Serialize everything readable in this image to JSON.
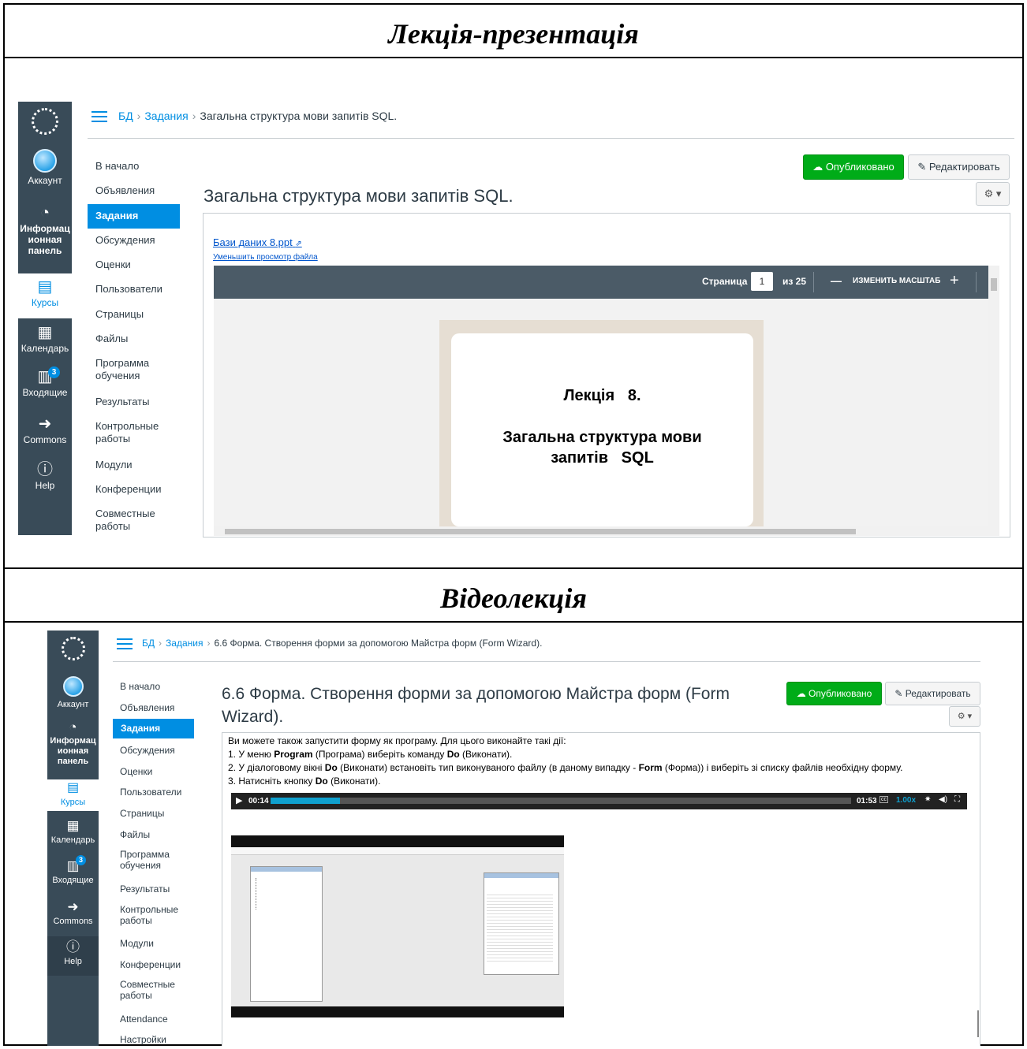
{
  "sections": {
    "top_title": "Лекція-презентація",
    "bottom_title": "Відеолекція"
  },
  "global_nav": {
    "account": "Аккаунт",
    "dashboard": "Информац ионная панель",
    "courses": "Курсы",
    "calendar": "Календарь",
    "inbox": "Входящие",
    "inbox_badge": "3",
    "commons": "Commons",
    "help": "Help"
  },
  "course_nav": {
    "home": "В начало",
    "announcements": "Объявления",
    "assignments": "Задания",
    "discussions": "Обсуждения",
    "grades": "Оценки",
    "people": "Пользователи",
    "pages": "Страницы",
    "files": "Файлы",
    "syllabus": "Программа обучения",
    "outcomes": "Результаты",
    "quizzes": "Контрольные работы",
    "modules": "Модули",
    "conferences": "Конференции",
    "collaborations": "Совместные работы",
    "attendance": "Attendance",
    "settings": "Настройки"
  },
  "breadcrumb": {
    "course": "БД",
    "section": "Задания",
    "sep": "›",
    "page1": "Загальна структура мови запитів SQL.",
    "page2": "6.6 Форма. Створення форми за допомогою Майстра форм (Form Wizard)."
  },
  "buttons": {
    "published": "Опубликовано",
    "edit": "Редактировать",
    "gear": "⚙ ▾"
  },
  "presentation": {
    "heading": "Загальна структура мови запитів SQL.",
    "file_link": "Бази даних 8.ppt",
    "collapse_link": "Уменьшить просмотр файла",
    "page_label": "Страница",
    "page_value": "1",
    "page_of": "из 25",
    "zoom_label": "ИЗМЕНИТЬ МАСШТАБ",
    "zoom_minus": "—",
    "zoom_plus": "+",
    "slide_line1": "Лекція   8.",
    "slide_line2": "Загальна структура мови",
    "slide_line3": "запитів   SQL"
  },
  "video_lecture": {
    "heading_line1": "6.6 Форма. Створення форми за допомогою Майстра форм (Form",
    "heading_line2": "Wizard).",
    "text_line1": "Ви можете також запустити форму як програму. Для цього виконайте такі дії:",
    "text_line2_a": "1. У меню ",
    "text_line2_b": "Program",
    "text_line2_c": " (Програма) виберіть команду ",
    "text_line2_d": "Do",
    "text_line2_e": " (Виконати).",
    "text_line3_a": "2. У діалоговому вікні ",
    "text_line3_b": "Do",
    "text_line3_c": " (Виконати) встановіть тип виконуваного файлу (в даному випадку - ",
    "text_line3_d": "Form",
    "text_line3_e": " (Форма)) і виберіть зі списку файлів необхідну форму.",
    "text_line4_a": "3. Натисніть кнопку ",
    "text_line4_b": "Do",
    "text_line4_c": " (Виконати).",
    "current_time": "00:14",
    "duration": "01:53",
    "speed": "1.00x",
    "progress": 0.12
  }
}
